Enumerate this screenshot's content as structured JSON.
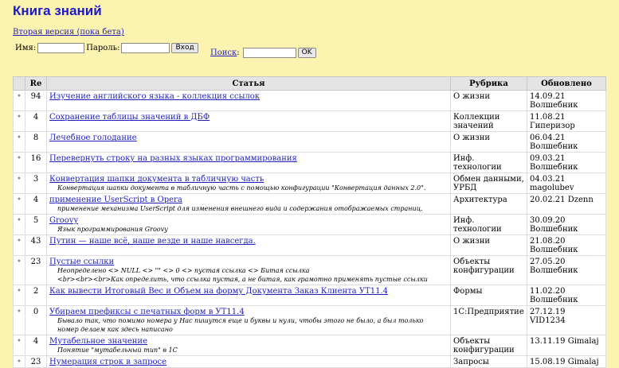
{
  "page_title": "Книга знаний",
  "beta_link": "Вторая версия (пока бета)",
  "login": {
    "user_label": "Имя",
    "pass_label": "Пароль",
    "submit_label": "Вход"
  },
  "search": {
    "label": "Поиск",
    "submit_label": "OK"
  },
  "table": {
    "headers": {
      "re": "Re",
      "article": "Статья",
      "rubric": "Рубрика",
      "updated": "Обновлено"
    },
    "rows": [
      {
        "bullet": "•",
        "re": "94",
        "title": "Изучение английского языка - коллекция ссылок",
        "desc": "",
        "desc2": "",
        "rubric": "О жизни",
        "updated": "14.09.21 Волшебник"
      },
      {
        "bullet": "•",
        "re": "4",
        "title": "Сохранение таблицы значений в ДБФ",
        "desc": "",
        "desc2": "",
        "rubric": "Коллекции значений",
        "updated": "11.08.21 Гиперизор"
      },
      {
        "bullet": "•",
        "re": "8",
        "title": "Лечебное голодание",
        "desc": "",
        "desc2": "",
        "rubric": "О жизни",
        "updated": "06.04.21 Волшебник"
      },
      {
        "bullet": "•",
        "re": "16",
        "title": "Перевернуть строку на разных языках программирования",
        "desc": "",
        "desc2": "",
        "rubric": "Инф. технологии",
        "updated": "09.03.21 Волшебник"
      },
      {
        "bullet": "•",
        "re": "3",
        "title": "Конвертация шапки документа в табличную часть",
        "desc": "Конвертация шапки документа в табличную часть с помощью конфигурации \"Конвертация данных 2.0\".",
        "desc2": "",
        "rubric": "Обмен данными, УРБД",
        "updated": "04.03.21 magolubev"
      },
      {
        "bullet": "•",
        "re": "4",
        "title": "применение UserScript в Opera",
        "desc": "применение механизма UserScript для изменения внешнего вида и содержания отображаемых страниц.",
        "desc2": "",
        "rubric": "Архитектура",
        "updated": "20.02.21 Dzenn"
      },
      {
        "bullet": "•",
        "re": "5",
        "title": "Groovy",
        "desc": "Язык программирования Groovy",
        "desc2": "",
        "rubric": "Инф. технологии",
        "updated": "30.09.20 Волшебник"
      },
      {
        "bullet": "•",
        "re": "43",
        "title": "Путин — наше всё, наше везде и наше навсегда.",
        "desc": "",
        "desc2": "",
        "rubric": "О жизни",
        "updated": "21.08.20 Волшебник"
      },
      {
        "bullet": "•",
        "re": "23",
        "title": "Пустые ссылки",
        "desc": "Неопределено <> NULL <> \"\" <> 0 <> пустая ссылка <> Битая ссылка",
        "desc2": "<br><br><br>Как определить, что ссылка пустая, а не битая, как грамотно применять пустые ссылки",
        "rubric": "Объекты конфигурации",
        "updated": "27.05.20 Волшебник"
      },
      {
        "bullet": "•",
        "re": "2",
        "title": "Как вывести Итоговый Вес и Объем на форму Документа Заказ Клиента УТ11.4",
        "desc": "",
        "desc2": "",
        "rubric": "Формы",
        "updated": "11.02.20 Волшебник"
      },
      {
        "bullet": "•",
        "re": "0",
        "title": "Убираем префиксы с печатных форм в УТ11.4",
        "desc": "Бывало так, что помимо номера у Нас пишутся еще и буквы и нули, чтобы этого не было, а был только",
        "desc2": "номер делаем как здесь написано",
        "rubric": "1С:Предприятие",
        "updated": "27.12.19 VID1234"
      },
      {
        "bullet": "•",
        "re": "4",
        "title": "Мутабельное значение",
        "desc": "Понятие \"мутабельный тип\" в 1С",
        "desc2": "",
        "rubric": "Объекты конфигурации",
        "updated": "13.11.19 Gimalaj"
      },
      {
        "bullet": "•",
        "re": "23",
        "title": "Нумерация строк в запросе",
        "desc": "",
        "desc2": "",
        "rubric": "Запросы",
        "updated": "15.08.19 Gimalaj"
      }
    ]
  }
}
